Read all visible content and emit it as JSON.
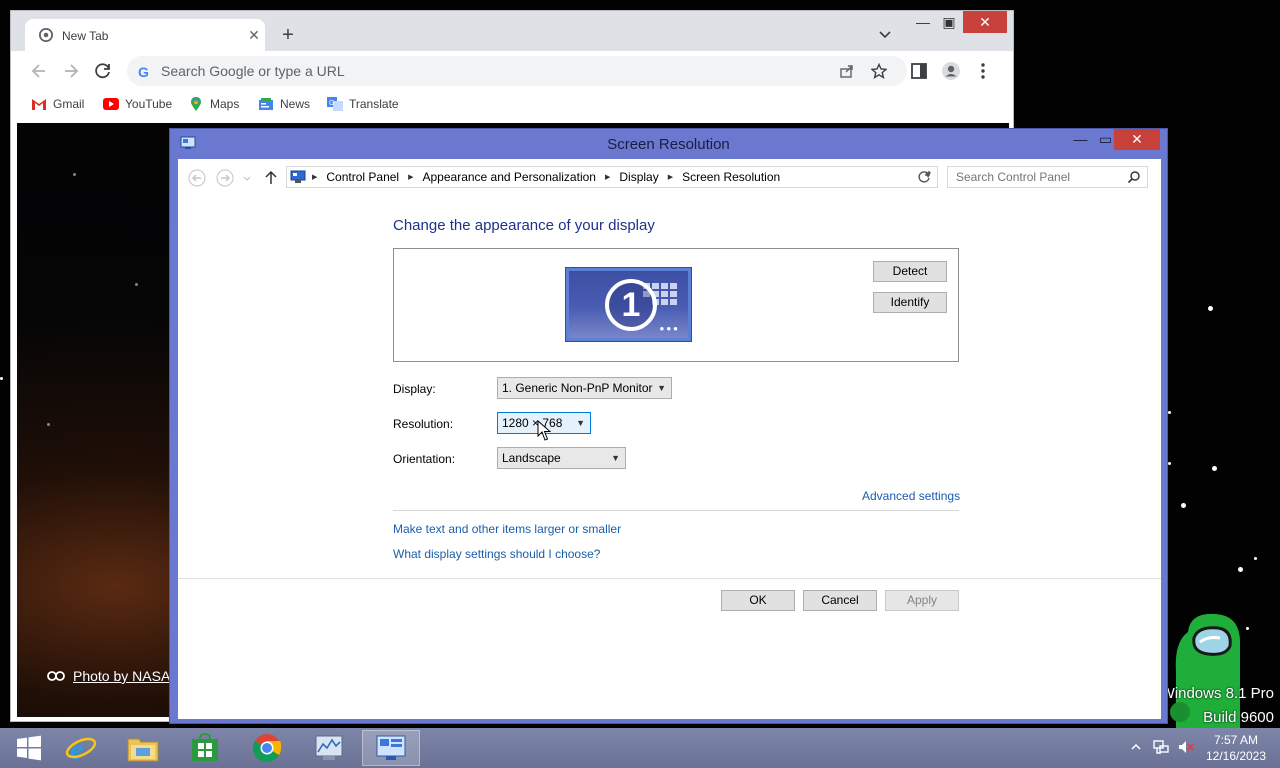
{
  "chrome": {
    "tab_title": "New Tab",
    "omnibox_placeholder": "Search Google or type a URL",
    "bookmarks": [
      {
        "label": "Gmail",
        "icon": "gmail-icon"
      },
      {
        "label": "YouTube",
        "icon": "youtube-icon"
      },
      {
        "label": "Maps",
        "icon": "maps-icon"
      },
      {
        "label": "News",
        "icon": "news-icon"
      },
      {
        "label": "Translate",
        "icon": "translate-icon"
      }
    ],
    "photo_credit": "Photo by NASA I"
  },
  "cp": {
    "title": "Screen Resolution",
    "breadcrumbs": [
      "Control Panel",
      "Appearance and Personalization",
      "Display",
      "Screen Resolution"
    ],
    "search_placeholder": "Search Control Panel",
    "heading": "Change the appearance of your display",
    "monitor_number": "1",
    "detect_label": "Detect",
    "identify_label": "Identify",
    "display_label": "Display:",
    "display_value": "1. Generic Non-PnP Monitor",
    "resolution_label": "Resolution:",
    "resolution_value": "1280 × 768",
    "orientation_label": "Orientation:",
    "orientation_value": "Landscape",
    "advanced_link": "Advanced settings",
    "link_text_size": "Make text and other items larger or smaller",
    "link_which_settings": "What display settings should I choose?",
    "ok_label": "OK",
    "cancel_label": "Cancel",
    "apply_label": "Apply"
  },
  "desktop": {
    "watermark_line1": "Windows 8.1 Pro",
    "watermark_line2": "Build 9600"
  },
  "taskbar": {
    "time": "7:57 AM",
    "date": "12/16/2023",
    "apps": [
      "start-icon",
      "internet-explorer-icon",
      "file-explorer-icon",
      "store-icon",
      "chrome-icon",
      "performance-monitor-icon",
      "control-panel-icon"
    ]
  },
  "colors": {
    "cp_frame": "#6b78cf",
    "close_red": "#c7403a",
    "link_blue": "#1c5dad",
    "heading_blue": "#1e3287"
  }
}
